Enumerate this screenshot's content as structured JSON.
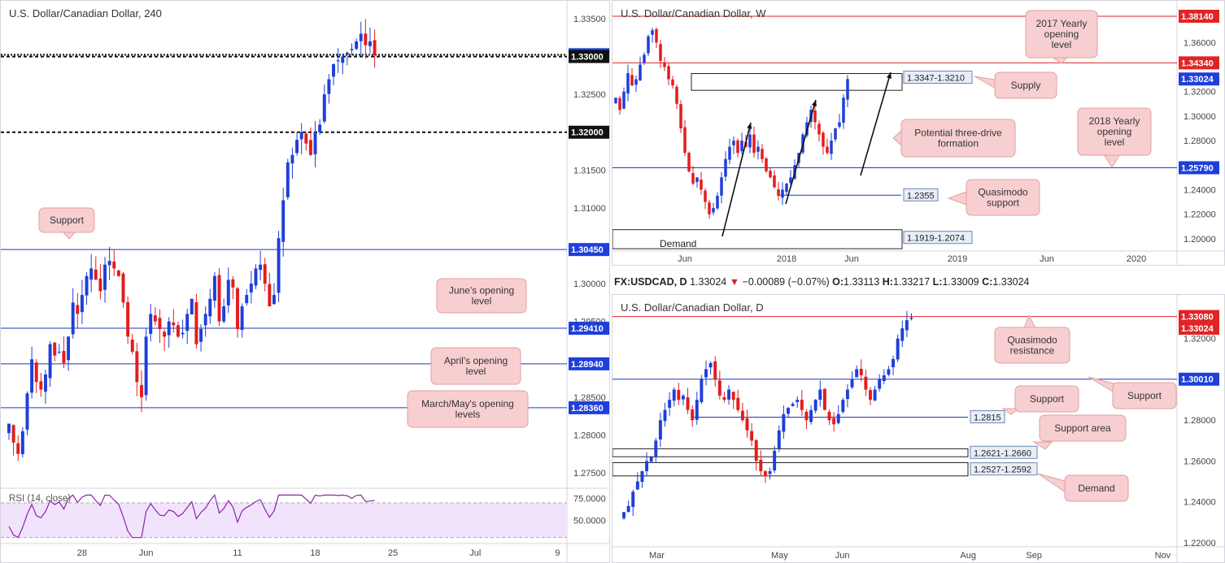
{
  "colors": {
    "up": "#1e3fd9",
    "down": "#e31c1c",
    "level_line": "#2238b8",
    "red_line": "#e02424",
    "callout_bg": "#f7cfd0",
    "callout_border": "#e39fa2",
    "rsi_fill": "#f1e3fb",
    "rsi_line": "#8e24aa"
  },
  "panels": {
    "left": {
      "title": "U.S. Dollar/Canadian Dollar, 240",
      "rsi_label": "RSI (14, close)"
    },
    "top_right": {
      "title": "U.S. Dollar/Canadian Dollar, W"
    },
    "bottom_right": {
      "title": "U.S. Dollar/Canadian Dollar, D",
      "info": {
        "symbol": "FX:USDCAD, D",
        "last": "1.33024",
        "change": "−0.00089 (−0.07%)",
        "o_label": "O:",
        "o": "1.33113",
        "h_label": "H:",
        "h": "1.33217",
        "l_label": "L:",
        "l": "1.33009",
        "c_label": "C:",
        "c": "1.33024"
      }
    }
  },
  "chart_data": [
    {
      "id": "h4",
      "type": "candlestick",
      "title": "U.S. Dollar/Canadian Dollar, 240",
      "ylim": [
        1.2735,
        1.3365
      ],
      "y_ticks": [
        "1.33500",
        "1.32500",
        "1.31500",
        "1.31000",
        "1.30000",
        "1.29500",
        "1.28500",
        "1.28000",
        "1.27500"
      ],
      "y_tick_values": [
        1.335,
        1.325,
        1.315,
        1.31,
        1.3,
        1.295,
        1.285,
        1.28,
        1.275
      ],
      "x_ticks": [
        {
          "label": "28",
          "index": 16
        },
        {
          "label": "Jun",
          "index": 30
        },
        {
          "label": "11",
          "index": 50
        },
        {
          "label": "18",
          "index": 67
        },
        {
          "label": "25",
          "index": 84
        },
        {
          "label": "Jul",
          "index": 102
        },
        {
          "label": "9",
          "index": 120
        }
      ],
      "n_slots": 122,
      "close_path": [
        1.2815,
        1.279,
        1.2775,
        1.2805,
        1.2855,
        1.29,
        1.287,
        1.286,
        1.288,
        1.292,
        1.2905,
        1.291,
        1.2895,
        1.293,
        1.2975,
        1.296,
        1.2985,
        1.301,
        1.302,
        1.3005,
        1.299,
        1.3025,
        1.303,
        1.302,
        1.301,
        1.2975,
        1.293,
        1.291,
        1.287,
        1.285,
        1.293,
        1.296,
        1.295,
        1.294,
        1.293,
        1.295,
        1.2945,
        1.293,
        1.2935,
        1.296,
        1.298,
        1.292,
        1.294,
        1.296,
        1.298,
        1.301,
        1.295,
        1.297,
        1.3005,
        1.2995,
        1.294,
        1.297,
        1.2985,
        1.3,
        1.302,
        1.3025,
        1.3,
        1.297,
        1.2985,
        1.306,
        1.311,
        1.316,
        1.317,
        1.319,
        1.32,
        1.3185,
        1.317,
        1.32,
        1.321,
        1.325,
        1.327,
        1.329,
        1.3295,
        1.33,
        1.3305,
        1.331,
        1.332,
        1.333,
        1.3315,
        1.332,
        1.3302
      ],
      "levels": [
        {
          "price": 1.33024,
          "label": "1.33024",
          "style": "dotted",
          "label_bg": "#1e3fd9"
        },
        {
          "price": 1.33,
          "label": "1.33000",
          "style": "dashed",
          "label_bg": "#111111"
        },
        {
          "price": 1.32,
          "label": "1.32000",
          "style": "dashed",
          "label_bg": "#111111"
        },
        {
          "price": 1.3045,
          "label": "1.30450",
          "style": "solid",
          "label_bg": "#1e3fd9"
        },
        {
          "price": 1.2941,
          "label": "1.29410",
          "style": "solid",
          "label_bg": "#1e3fd9"
        },
        {
          "price": 1.2894,
          "label": "1.28940",
          "style": "solid",
          "label_bg": "#1e3fd9"
        },
        {
          "price": 1.2836,
          "label": "1.28360",
          "style": "solid",
          "label_bg": "#1e3fd9"
        }
      ],
      "annotations": [
        "Support",
        "June's opening level",
        "April's opening level",
        "March/May's opening levels"
      ],
      "rsi": {
        "label": "RSI (14, close)",
        "y_ticks": [
          "75.0000",
          "50.0000"
        ],
        "ylim": [
          25,
          85
        ],
        "band": [
          30,
          70
        ]
      }
    },
    {
      "id": "weekly",
      "type": "candlestick",
      "title": "U.S. Dollar/Canadian Dollar, W",
      "ylim": [
        1.19,
        1.39
      ],
      "y_ticks": [
        "1.36000",
        "1.32000",
        "1.30000",
        "1.28000",
        "1.24000",
        "1.22000",
        "1.20000"
      ],
      "y_tick_values": [
        1.36,
        1.32,
        1.3,
        1.28,
        1.24,
        1.22,
        1.2
      ],
      "x_ticks": [
        {
          "label": "Jun",
          "index": 17
        },
        {
          "label": "2018",
          "index": 42
        },
        {
          "label": "Jun",
          "index": 58
        },
        {
          "label": "2019",
          "index": 84
        },
        {
          "label": "Jun",
          "index": 106
        },
        {
          "label": "2020",
          "index": 128
        }
      ],
      "n_slots": 138,
      "close_path": [
        1.315,
        1.305,
        1.32,
        1.335,
        1.325,
        1.33,
        1.342,
        1.35,
        1.365,
        1.37,
        1.36,
        1.345,
        1.34,
        1.33,
        1.325,
        1.31,
        1.29,
        1.27,
        1.255,
        1.245,
        1.25,
        1.24,
        1.23,
        1.22,
        1.225,
        1.235,
        1.25,
        1.265,
        1.275,
        1.28,
        1.27,
        1.28,
        1.275,
        1.285,
        1.27,
        1.275,
        1.265,
        1.255,
        1.25,
        1.242,
        1.235,
        1.24,
        1.245,
        1.25,
        1.26,
        1.27,
        1.285,
        1.295,
        1.305,
        1.295,
        1.285,
        1.275,
        1.27,
        1.28,
        1.29,
        1.295,
        1.315,
        1.3302
      ],
      "levels": [
        {
          "price": 1.3814,
          "label": "1.38140",
          "label_bg": "#e02424",
          "color": "#e02424"
        },
        {
          "price": 1.3434,
          "label": "1.34340",
          "label_bg": "#e02424",
          "color": "#e02424"
        },
        {
          "price": 1.33024,
          "label": "1.33024",
          "label_bg": "#1e3fd9",
          "color": null
        },
        {
          "price": 1.2579,
          "label": "1.25790",
          "label_bg": "#1e3fd9",
          "color": "#2238b8"
        }
      ],
      "zones": [
        {
          "label": "1.3347-1.3210",
          "top": 1.3347,
          "bottom": 1.321
        },
        {
          "label": "1.1919-1.2074",
          "top": 1.2074,
          "bottom": 1.1919
        }
      ],
      "level_tags": [
        {
          "label": "1.2355",
          "price": 1.2355
        }
      ],
      "annotations": [
        "2017 Yearly opening level",
        "Supply",
        "Potential three-drive formation",
        "2018 Yearly opening level",
        "Quasimodo support",
        "Demand"
      ]
    },
    {
      "id": "daily",
      "type": "candlestick",
      "title": "U.S. Dollar/Canadian Dollar, D",
      "ylim": [
        1.218,
        1.339
      ],
      "y_ticks": [
        "1.32000",
        "1.28000",
        "1.26000",
        "1.24000",
        "1.22000"
      ],
      "y_tick_values": [
        1.32,
        1.28,
        1.26,
        1.24,
        1.22
      ],
      "x_ticks": [
        {
          "label": "Mar",
          "index": 11
        },
        {
          "label": "May",
          "index": 52
        },
        {
          "label": "Jun",
          "index": 73
        },
        {
          "label": "Aug",
          "index": 115
        },
        {
          "label": "Sep",
          "index": 137
        },
        {
          "label": "Nov",
          "index": 180
        }
      ],
      "n_slots": 184,
      "close_path": [
        1.235,
        1.238,
        1.245,
        1.25,
        1.255,
        1.26,
        1.262,
        1.27,
        1.28,
        1.285,
        1.29,
        1.295,
        1.29,
        1.292,
        1.285,
        1.28,
        1.29,
        1.3,
        1.305,
        1.308,
        1.3,
        1.292,
        1.29,
        1.295,
        1.29,
        1.285,
        1.28,
        1.275,
        1.27,
        1.26,
        1.255,
        1.253,
        1.255,
        1.265,
        1.275,
        1.283,
        1.286,
        1.288,
        1.29,
        1.285,
        1.28,
        1.285,
        1.29,
        1.295,
        1.285,
        1.28,
        1.278,
        1.283,
        1.29,
        1.295,
        1.3,
        1.305,
        1.302,
        1.295,
        1.29,
        1.295,
        1.3,
        1.302,
        1.305,
        1.31,
        1.32,
        1.325,
        1.329,
        1.3302
      ],
      "levels": [
        {
          "price": 1.3308,
          "label": "1.33080",
          "label_bg": "#e02424",
          "color": "#e02424"
        },
        {
          "price": 1.33024,
          "label": "1.33024",
          "label_bg": "#e02424",
          "color": null
        },
        {
          "price": 1.3001,
          "label": "1.30010",
          "label_bg": "#1e3fd9",
          "color": "#2238b8"
        }
      ],
      "zones": [
        {
          "label": "1.2621-1.2660",
          "top": 1.266,
          "bottom": 1.2621
        },
        {
          "label": "1.2527-1.2592",
          "top": 1.2592,
          "bottom": 1.2527
        }
      ],
      "level_tags": [
        {
          "label": "1.2815",
          "price": 1.2815
        }
      ],
      "annotations": [
        "Quasimodo resistance",
        "Support",
        "Support",
        "Support area",
        "Demand"
      ]
    }
  ]
}
